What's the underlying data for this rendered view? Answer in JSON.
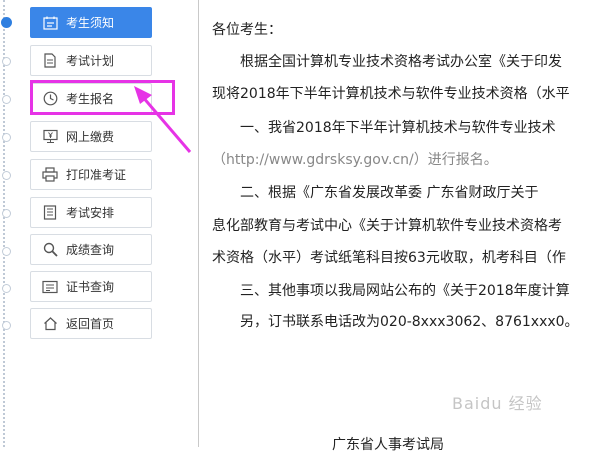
{
  "sidebar": {
    "items": [
      {
        "label": "考生须知",
        "icon": "notice-icon",
        "active": true
      },
      {
        "label": "考试计划",
        "icon": "document-icon",
        "active": false
      },
      {
        "label": "考生报名",
        "icon": "clock-icon",
        "active": false
      },
      {
        "label": "网上缴费",
        "icon": "monitor-yen-icon",
        "active": false
      },
      {
        "label": "打印准考证",
        "icon": "printer-icon",
        "active": false
      },
      {
        "label": "考试安排",
        "icon": "list-document-icon",
        "active": false
      },
      {
        "label": "成绩查询",
        "icon": "search-icon",
        "active": false
      },
      {
        "label": "证书查询",
        "icon": "certificate-icon",
        "active": false
      },
      {
        "label": "返回首页",
        "icon": "home-icon",
        "active": false
      }
    ]
  },
  "content": {
    "greeting": "各位考生：",
    "lines": [
      "根据全国计算机专业技术资格考试办公室《关于印发",
      "现将2018年下半年计算机技术与软件专业技术资格（水平",
      "一、我省2018年下半年计算机技术与软件专业技术",
      "（http://www.gdrsksy.gov.cn/）进行报名。",
      "二、根据《广东省发展改革委 广东省财政厅关于",
      "息化部教育与考试中心《关于计算机软件专业技术资格考",
      "术资格（水平）考试纸笔科目按63元收取，机考科目（作",
      "三、其他事项以我局网站公布的《关于2018年度计算",
      "另，订书联系电话改为020-8xxx3062、8761xxx0。"
    ],
    "signature": "广东省人事考试局"
  },
  "watermark": "Baidu 经验",
  "colors": {
    "accent": "#3a86e8",
    "highlight": "#e633e6"
  }
}
